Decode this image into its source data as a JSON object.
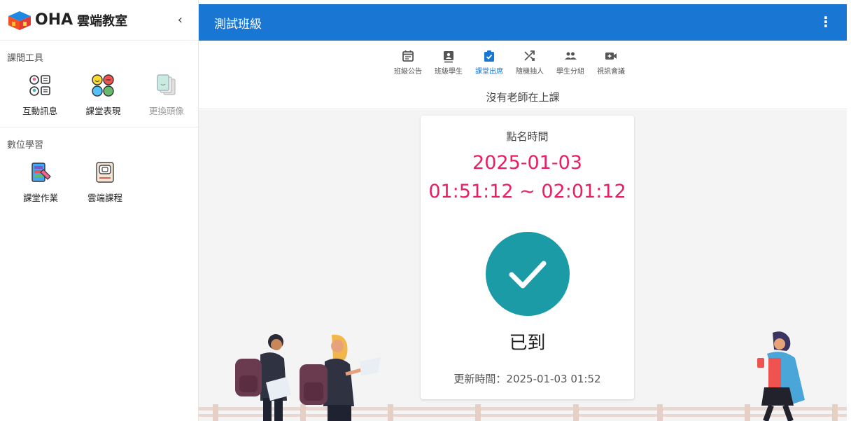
{
  "app": {
    "logo_text": "OHA",
    "logo_sub": "雲端教室",
    "collapse_glyph": "‹"
  },
  "sidebar": {
    "sections": [
      {
        "title": "課間工具",
        "items": [
          {
            "label": "互動訊息",
            "icon": "interactive-message-icon",
            "enabled": true
          },
          {
            "label": "課堂表現",
            "icon": "class-performance-icon",
            "enabled": true
          },
          {
            "label": "更換頭像",
            "icon": "change-avatar-icon",
            "enabled": false
          }
        ]
      },
      {
        "title": "數位學習",
        "items": [
          {
            "label": "課堂作業",
            "icon": "homework-icon",
            "enabled": true
          },
          {
            "label": "雲端課程",
            "icon": "cloud-course-icon",
            "enabled": true
          }
        ]
      }
    ]
  },
  "header": {
    "title": "測試班級",
    "more_glyph": "⋮"
  },
  "tabs": [
    {
      "label": "班級公告",
      "icon": "announcement-icon",
      "active": false
    },
    {
      "label": "班級學生",
      "icon": "students-icon",
      "active": false
    },
    {
      "label": "課堂出席",
      "icon": "attendance-icon",
      "active": true
    },
    {
      "label": "隨機抽人",
      "icon": "shuffle-icon",
      "active": false
    },
    {
      "label": "學生分組",
      "icon": "group-icon",
      "active": false
    },
    {
      "label": "視訊會議",
      "icon": "video-call-icon",
      "active": false
    }
  ],
  "status_line": "沒有老師在上課",
  "attendance": {
    "label": "點名時間",
    "date": "2025-01-03",
    "time_range": "01:51:12 ~ 02:01:12",
    "status": "已到",
    "updated": "更新時間：2025-01-03 01:52"
  },
  "colors": {
    "primary": "#1976d2",
    "accent": "#e91e63",
    "check": "#1a9ba6"
  }
}
